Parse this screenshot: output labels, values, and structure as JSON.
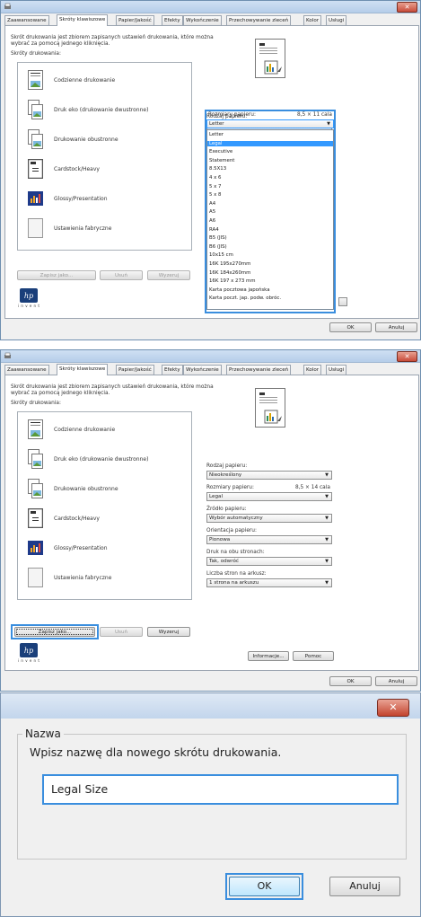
{
  "tabs": [
    "Zaawansowane",
    "Skróty klawiszowe",
    "Papier/Jakość",
    "Efekty",
    "Wykończenie",
    "Przechowywanie zleceń",
    "Kolor",
    "Usługi"
  ],
  "description": [
    "Skrót drukowania jest zbiorem zapisanych ustawień drukowania, które można",
    "wybrać za pomocą jednego kliknięcia."
  ],
  "shortcuts_label": "Skróty drukowania:",
  "shortcuts": [
    "Codzienne drukowanie",
    "Druk eko (drukowanie dwustronne)",
    "Drukowanie obustronne",
    "Cardstock/Heavy",
    "Glossy/Presentation",
    "Ustawienia fabryczne"
  ],
  "buttons": {
    "save_as": "Zapisz jako...",
    "delete": "Usuń",
    "reset": "Wyzeruj",
    "about": "Informacje...",
    "help": "Pomoc",
    "ok": "OK",
    "cancel": "Anuluj"
  },
  "paper_type": {
    "label": "Rodzaj papieru:",
    "value": "Nieokreślony"
  },
  "paper_size": {
    "label": "Rozmiary papieru:",
    "size1": "8,5 × 11 cala",
    "value1": "Letter",
    "size2": "8,5 × 14 cala",
    "value2": "Legal"
  },
  "paper_options": [
    "Letter",
    "Legal",
    "Executive",
    "Statement",
    "8.5X13",
    "4 x 6",
    "5 x 7",
    "5 x 8",
    "A4",
    "A5",
    "A6",
    "RA4",
    "B5 (JIS)",
    "B6 (JIS)",
    "10x15 cm",
    "16K 195x270mm",
    "16K 184x260mm",
    "16K 197 x 273 mm",
    "Karta pocztowa japońska",
    "Karta poczt. jap. podw. obróc."
  ],
  "paper_source": {
    "label": "Źródło papieru:",
    "value": "Wybór automatyczny"
  },
  "orientation": {
    "label": "Orientacja papieru:",
    "value": "Pionowa"
  },
  "duplex": {
    "label": "Druk na obu stronach:",
    "value": "Tak, odwróć"
  },
  "pages_per_sheet": {
    "label": "Liczba stron na arkusz:",
    "value": "1 strona na arkuszu"
  },
  "hp_invent": "i n v e n t",
  "dialog": {
    "group_label": "Nazwa",
    "prompt": "Wpisz nazwę dla nowego skrótu drukowania.",
    "input_value": "Legal Size",
    "ok": "OK",
    "cancel": "Anuluj"
  },
  "colors": {
    "highlight": "#3a8ede",
    "selection": "#3399ff",
    "close": "#c84c3a"
  }
}
